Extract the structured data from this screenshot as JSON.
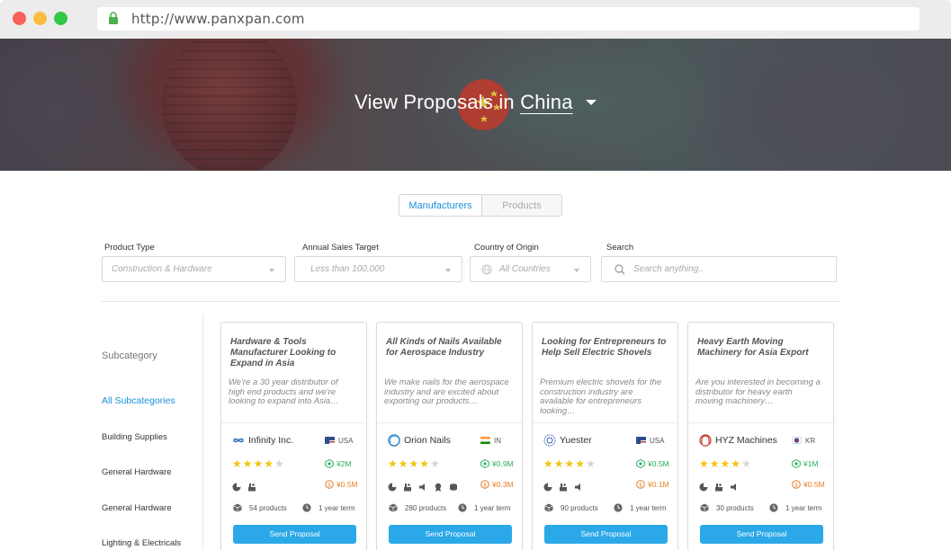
{
  "browser": {
    "url": "http://www.panxpan.com"
  },
  "hero": {
    "title_prefix": "View Proposals in",
    "country": "China"
  },
  "tabs": [
    {
      "label": "Manufacturers",
      "active": true
    },
    {
      "label": "Products",
      "active": false
    }
  ],
  "filters": {
    "product_type": {
      "label": "Product Type",
      "placeholder": "Construction & Hardware"
    },
    "annual_sales": {
      "label": "Annual Sales Target",
      "placeholder": "Less than 100,000"
    },
    "country": {
      "label": "Country of Origin",
      "placeholder": "All Countries"
    },
    "search": {
      "label": "Search",
      "placeholder": "Search anything.."
    }
  },
  "sidebar": {
    "title": "Subcategory",
    "items": [
      {
        "label": "All Subcategories",
        "active": true
      },
      {
        "label": "Building Supplies",
        "active": false
      },
      {
        "label": "General Hardware",
        "active": false
      },
      {
        "label": "General Hardware",
        "active": false
      },
      {
        "label": "Lighting & Electricals",
        "active": false
      }
    ]
  },
  "cards": [
    {
      "title": "Hardware & Tools Manufacturer Looking to Expand in Asia",
      "description": "We're a 30 year distributor of high end products and we're looking to expand into Asia…",
      "company": "Infinity Inc.",
      "country_code": "USA",
      "rating": 4,
      "metric1": "¥2M",
      "metric2": "¥0.5M",
      "products": "54 products",
      "term": "1 year term",
      "button": "Send Proposal",
      "logo_icon": "infinity-logo-icon",
      "flag_icon": "us-flag-icon"
    },
    {
      "title": "All Kinds of Nails Available for Aerospace Industry",
      "description": "We make nails for the aerospace industry and are excited about exporting our products…",
      "company": "Orion Nails",
      "country_code": "IN",
      "rating": 4,
      "metric1": "¥0.9M",
      "metric2": "¥0.3M",
      "products": "280 products",
      "term": "1 year term",
      "button": "Send Proposal",
      "logo_icon": "orion-logo-icon",
      "flag_icon": "india-flag-icon"
    },
    {
      "title": "Looking for Entrepreneurs to Help Sell Electric Shovels",
      "description": "Premium electric shovels for the construction industry are available for entrepreneurs looking…",
      "company": "Yuester",
      "country_code": "USA",
      "rating": 4,
      "metric1": "¥0.5M",
      "metric2": "¥0.1M",
      "products": "90 products",
      "term": "1 year term",
      "button": "Send Proposal",
      "logo_icon": "yuester-logo-icon",
      "flag_icon": "us-flag-icon"
    },
    {
      "title": "Heavy Earth Moving Machinery for Asia Export",
      "description": "Are you interested in becoming a distributor for heavy earth moving machinery…",
      "company": "HYZ Machines",
      "country_code": "KR",
      "rating": 4,
      "metric1": "¥1M",
      "metric2": "¥0.5M",
      "products": "30 products",
      "term": "1 year term",
      "button": "Send Proposal",
      "logo_icon": "hyz-logo-icon",
      "flag_icon": "korea-flag-icon"
    }
  ],
  "colors": {
    "accent": "#1a8fd8",
    "button": "#2aa8e8",
    "metric_green": "#27ae60",
    "metric_orange": "#e67e22",
    "star": "#f1c40f"
  }
}
